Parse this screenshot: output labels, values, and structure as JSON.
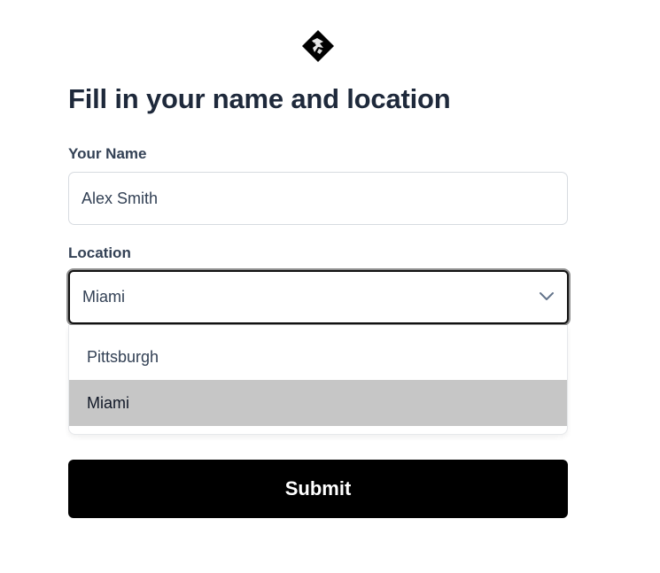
{
  "logo": {
    "icon": "diamond-logo-icon"
  },
  "page": {
    "title": "Fill in your name and location"
  },
  "form": {
    "name": {
      "label": "Your Name",
      "value": "Alex Smith"
    },
    "location": {
      "label": "Location",
      "selected": "Miami",
      "chevron_icon": "chevron-down-icon",
      "options": [
        {
          "label": "Pittsburgh",
          "highlighted": false
        },
        {
          "label": "Miami",
          "highlighted": true
        }
      ]
    },
    "submit_label": "Submit"
  },
  "colors": {
    "title": "#1e293b",
    "submit_bg": "#000000",
    "option_highlight": "#c6c6c6"
  }
}
